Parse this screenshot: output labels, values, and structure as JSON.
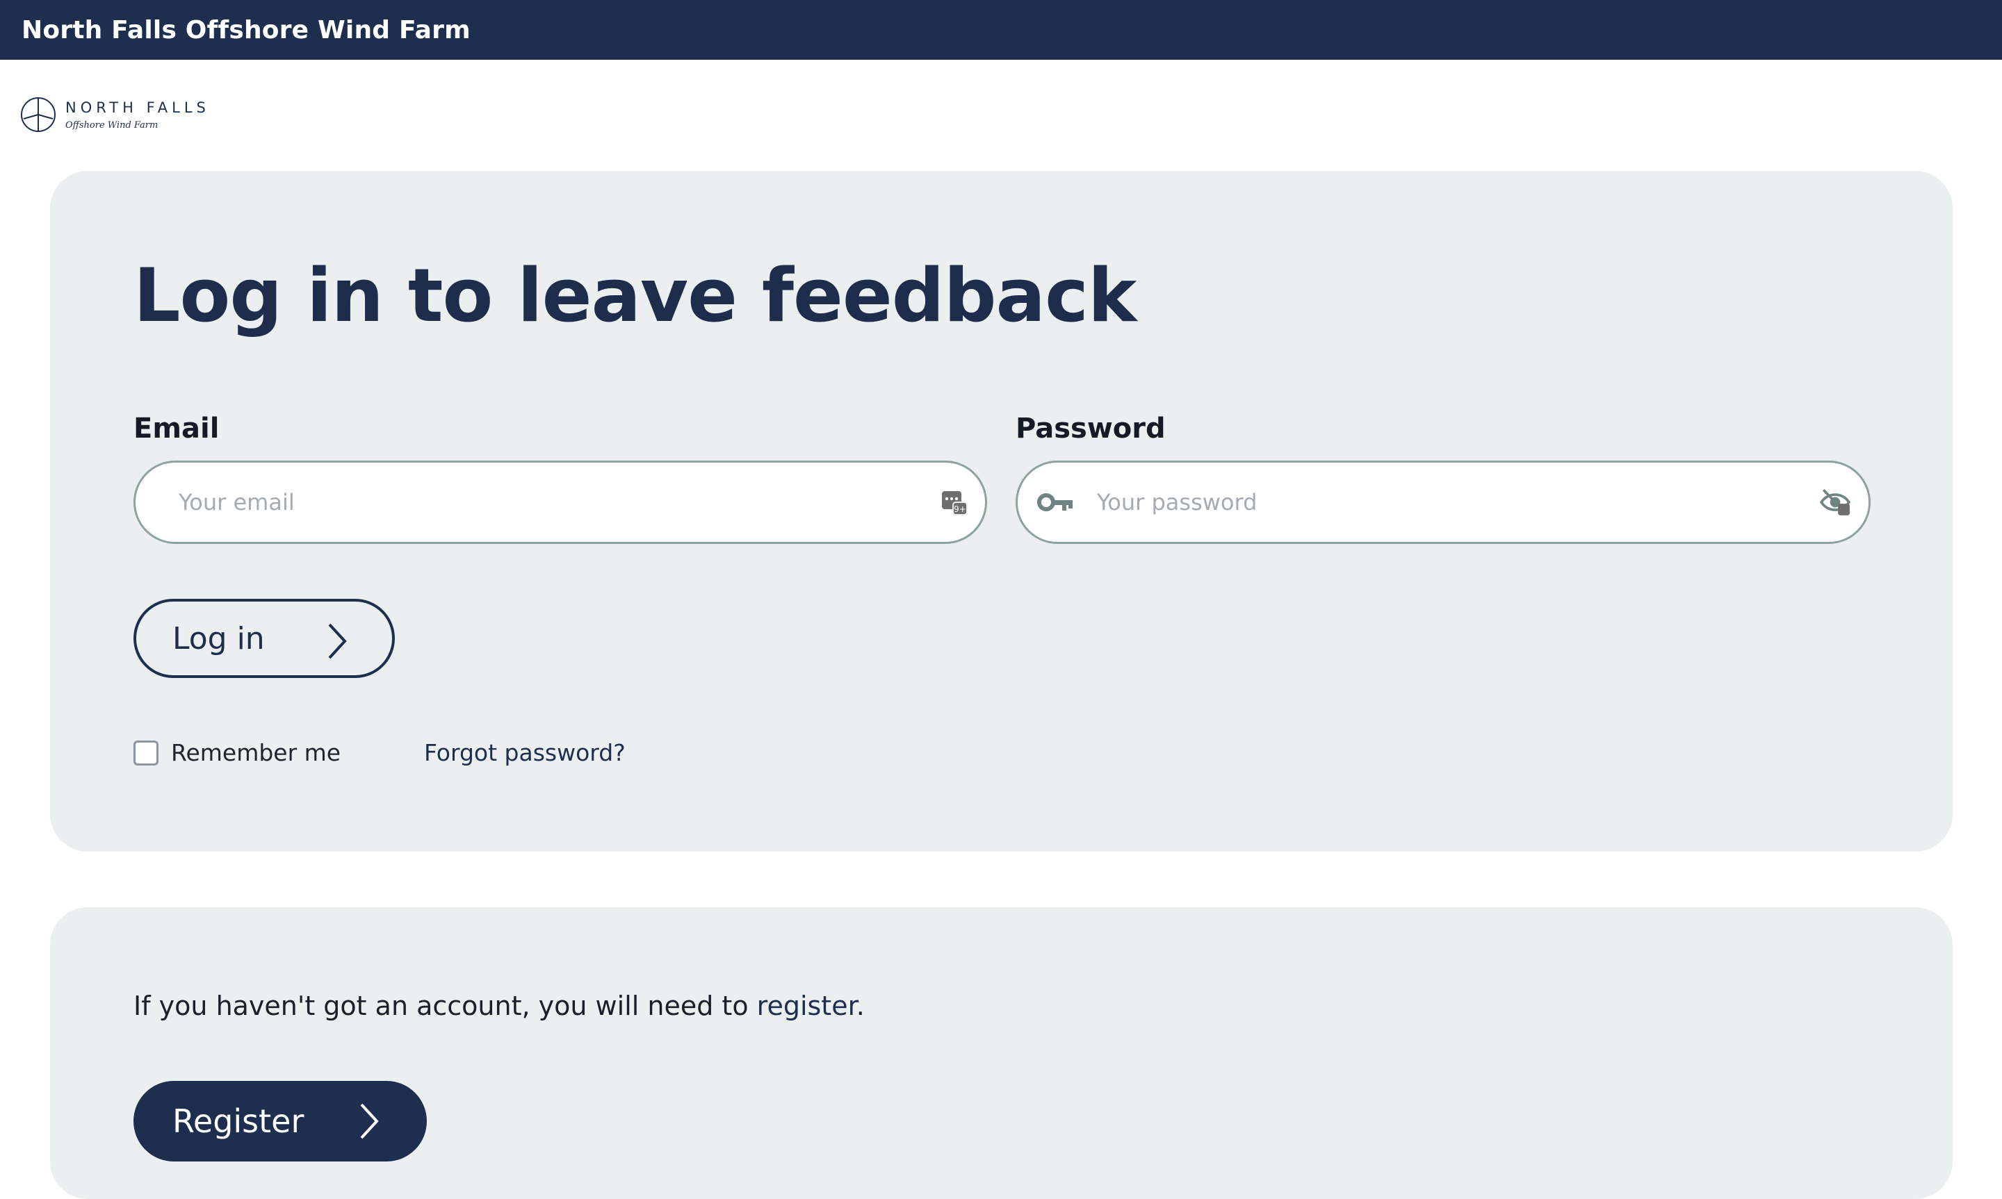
{
  "header": {
    "title": "North Falls Offshore Wind Farm"
  },
  "logo": {
    "main_text": "NORTH FALLS",
    "sub_text": "Offshore Wind Farm"
  },
  "login": {
    "heading": "Log in to leave feedback",
    "email_label": "Email",
    "email_placeholder": "Your email",
    "email_value": "",
    "password_label": "Password",
    "password_placeholder": "Your password",
    "password_value": "",
    "login_button": "Log in",
    "remember_label": "Remember me",
    "remember_checked": false,
    "forgot_link": "Forgot password?"
  },
  "register": {
    "text_prefix": "If you haven't got an account, you will need to ",
    "link_text": "register",
    "text_suffix": ".",
    "button_label": "Register"
  },
  "icons": {
    "email_autofill": "password-manager-icon",
    "password_key": "key-icon",
    "password_toggle": "eye-hidden-icon",
    "button_arrow": "chevron-right-icon",
    "logo": "wind-turbine-icon"
  },
  "colors": {
    "brand_navy": "#1d2e4f",
    "card_bg": "#ebeff0",
    "input_border": "#8ea29f"
  }
}
